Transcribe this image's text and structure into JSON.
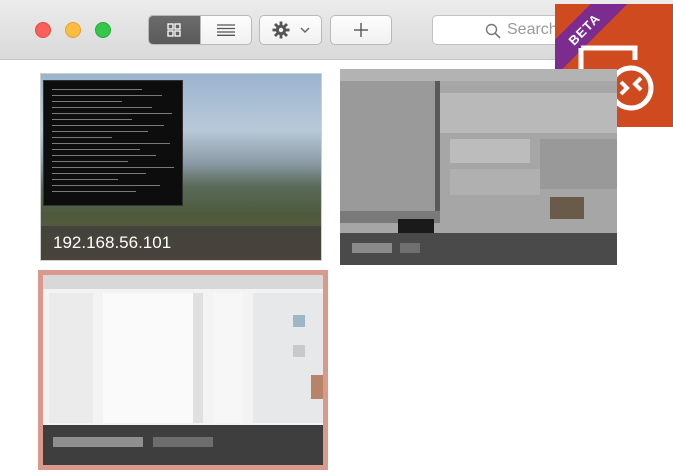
{
  "toolbar": {
    "view_modes": [
      {
        "name": "grid",
        "icon": "grid-view-icon",
        "active": true
      },
      {
        "name": "list",
        "icon": "list-view-icon",
        "active": false
      }
    ],
    "settings_icon": "gear-icon",
    "settings_dropdown_icon": "chevron-down-icon",
    "add_icon": "plus-icon",
    "search": {
      "placeholder": "Search",
      "value": ""
    }
  },
  "logo": {
    "badge": "BETA",
    "icon": "remote-desktop-icon"
  },
  "connections": [
    {
      "label": "192.168.56.101",
      "selected": false
    },
    {
      "label": "",
      "selected": false
    },
    {
      "label": "",
      "selected": true
    }
  ],
  "colors": {
    "logo_bg": "#d04a1f",
    "badge_bg": "#7b2c8e",
    "selection_border": "#d9998c"
  }
}
